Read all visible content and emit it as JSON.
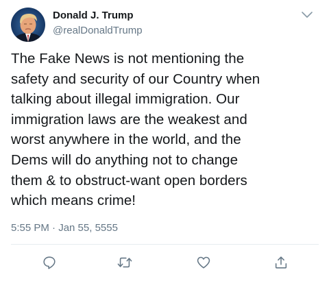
{
  "author": {
    "display_name": "Donald J. Trump",
    "handle": "@realDonaldTrump"
  },
  "tweet": {
    "text": "The Fake News is not mentioning the\nsafety and security of our Country when\ntalking about illegal immigration. Our\nimmigration laws are the weakest and\nworst anywhere in the world, and the\nDems will do anything not to change\nthem & to obstruct-want open borders\nwhich means crime!",
    "timestamp": "5:55 PM · Jan 55, 5555"
  },
  "actions": [
    {
      "icon": "reply-icon"
    },
    {
      "icon": "retweet-icon"
    },
    {
      "icon": "heart-icon"
    },
    {
      "icon": "share-icon"
    }
  ],
  "colors": {
    "text": "#14171a",
    "secondary": "#657786",
    "icon": "#657786",
    "divider": "#e6ecf0"
  }
}
